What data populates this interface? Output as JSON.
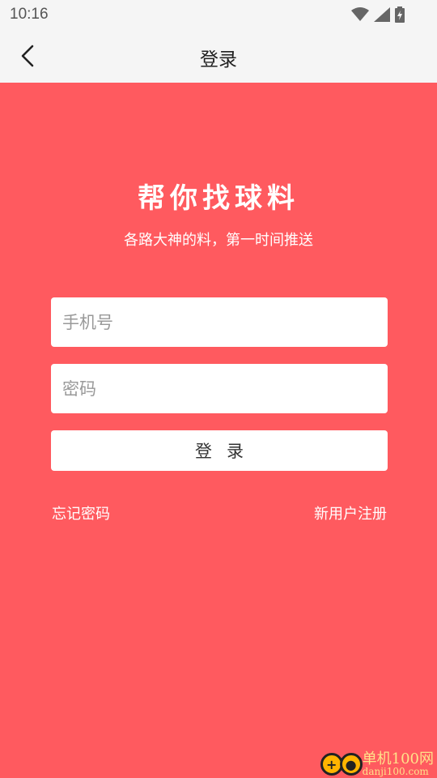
{
  "status_bar": {
    "time": "10:16",
    "icons": [
      "wifi-icon",
      "signal-icon",
      "battery-icon"
    ]
  },
  "nav": {
    "title": "登录",
    "back_icon": "chevron-left-icon"
  },
  "hero": {
    "headline": "帮你找球料",
    "subheadline": "各路大神的料，第一时间推送"
  },
  "form": {
    "phone_placeholder": "手机号",
    "phone_value": "",
    "password_placeholder": "密码",
    "password_value": "",
    "login_label": "登录"
  },
  "links": {
    "forgot_password": "忘记密码",
    "register": "新用户注册"
  },
  "watermark": {
    "name": "单机100网",
    "domain": "danji100.com"
  },
  "colors": {
    "background": "#ff5a5f",
    "bar": "#f5f5f5",
    "field": "#ffffff"
  }
}
